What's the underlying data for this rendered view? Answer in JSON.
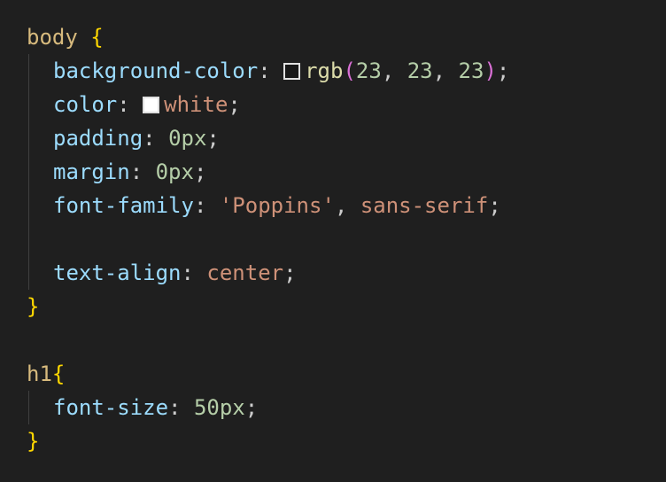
{
  "colors": {
    "background": "#1f1f1f",
    "selector": "#d7ba7d",
    "brace": "#ffd700",
    "paren": "#da70d6",
    "property": "#9cdcfe",
    "number": "#b5cea8",
    "string": "#ce9178",
    "function": "#dcdcaa",
    "punctuation": "#cccccc"
  },
  "code": {
    "body_rule": {
      "selector": "body",
      "open_brace": "{",
      "close_brace": "}",
      "bg": {
        "property": "background-color",
        "colon": ": ",
        "swatch_color": "rgb(23, 23, 23)",
        "func": "rgb",
        "open_paren": "(",
        "r": "23",
        "g": "23",
        "b": "23",
        "comma": ", ",
        "close_paren": ")",
        "semi": ";"
      },
      "color": {
        "property": "color",
        "colon": ": ",
        "swatch_color": "white",
        "value": "white",
        "semi": ";"
      },
      "padding": {
        "property": "padding",
        "colon": ": ",
        "value": "0px",
        "semi": ";"
      },
      "margin": {
        "property": "margin",
        "colon": ": ",
        "value": "0px",
        "semi": ";"
      },
      "font_family": {
        "property": "font-family",
        "colon": ": ",
        "value1": "'Poppins'",
        "comma": ", ",
        "value2": "sans-serif",
        "semi": ";"
      },
      "text_align": {
        "property": "text-align",
        "colon": ": ",
        "value": "center",
        "semi": ";"
      }
    },
    "h1_rule": {
      "selector": "h1",
      "open_brace": "{",
      "close_brace": "}",
      "font_size": {
        "property": "font-size",
        "colon": ": ",
        "value": "50px",
        "semi": ";"
      }
    }
  }
}
